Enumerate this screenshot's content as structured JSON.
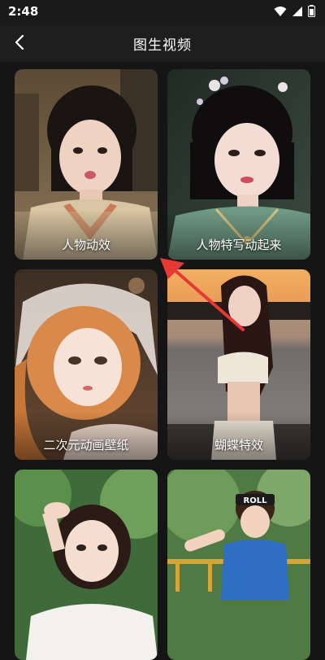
{
  "status": {
    "time": "2:48"
  },
  "nav": {
    "title": "图生视频"
  },
  "cards": [
    {
      "caption": "人物动效"
    },
    {
      "caption": "人物特写动起来"
    },
    {
      "caption": "二次元动画壁纸"
    },
    {
      "caption": "蝴蝶特效"
    },
    {
      "caption": ""
    },
    {
      "caption": ""
    }
  ],
  "badge": {
    "text": "ROLL"
  },
  "icons": {
    "back": "chevron-left-icon",
    "wifi": "wifi-icon",
    "signal": "signal-icon",
    "battery": "battery-icon"
  },
  "colors": {
    "background": "#151515",
    "annotation_arrow": "#e53935"
  }
}
